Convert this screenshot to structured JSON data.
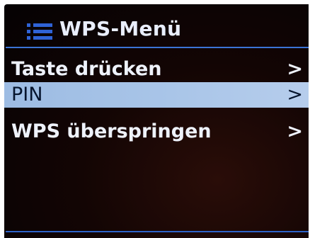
{
  "header": {
    "title": "WPS-Menü",
    "icon": "menu-list-icon",
    "accent_color": "#3b74d6"
  },
  "menu": {
    "items": [
      {
        "label": "Taste drücken",
        "chevron": ">",
        "selected": false
      },
      {
        "label": "PIN",
        "chevron": ">",
        "selected": true
      },
      {
        "label": "WPS überspringen",
        "chevron": ">",
        "selected": false
      }
    ],
    "selection_color": "#a9c5e8"
  }
}
